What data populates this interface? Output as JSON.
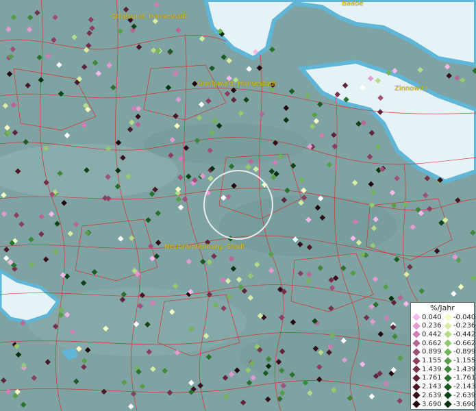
{
  "map": {
    "places": [
      {
        "name": "Stralsund, Hansestadt",
        "id": "stralsund"
      },
      {
        "name": "Baabe",
        "id": "baabe"
      },
      {
        "name": "Greifswald, Hansestadt",
        "id": "greifswald"
      },
      {
        "name": "Zinnowitz",
        "id": "zinnowitz"
      },
      {
        "name": "Neubrandenburg, Stadt",
        "id": "neubrandenburg"
      }
    ],
    "colors": {
      "land": "#7fa3a3",
      "water": "#e6f3f6",
      "coast": "#5fb6d6",
      "borders": "#e02020",
      "label": "#e3c21a"
    }
  },
  "legend": {
    "title": "%/Jahr",
    "positive": [
      {
        "value": "0.040",
        "color": "#f5b8ea"
      },
      {
        "value": "0.236",
        "color": "#e39ad3"
      },
      {
        "value": "0.442",
        "color": "#cf7cb7"
      },
      {
        "value": "0.662",
        "color": "#b86597"
      },
      {
        "value": "0.899",
        "color": "#a04f7a"
      },
      {
        "value": "1.155",
        "color": "#8a3e60"
      },
      {
        "value": "1.439",
        "color": "#74304b"
      },
      {
        "value": "1.761",
        "color": "#5e2338"
      },
      {
        "value": "2.143",
        "color": "#491826"
      },
      {
        "value": "2.639",
        "color": "#340e18"
      },
      {
        "value": "3.690",
        "color": "#22060d"
      }
    ],
    "negative": [
      {
        "value": "-0.040",
        "color": "#f6fbc4"
      },
      {
        "value": "-0.236",
        "color": "#d8eca4"
      },
      {
        "value": "-0.442",
        "color": "#b6db88"
      },
      {
        "value": "-0.662",
        "color": "#94c96f"
      },
      {
        "value": "-0.899",
        "color": "#73b45a"
      },
      {
        "value": "-1.155",
        "color": "#579e48"
      },
      {
        "value": "-1.439",
        "color": "#3e8739"
      },
      {
        "value": "-1.761",
        "color": "#2a712d"
      },
      {
        "value": "-2.143",
        "color": "#1b5a22"
      },
      {
        "value": "-2.639",
        "color": "#0f4418"
      },
      {
        "value": "-3.690",
        "color": "#07300f"
      }
    ]
  }
}
